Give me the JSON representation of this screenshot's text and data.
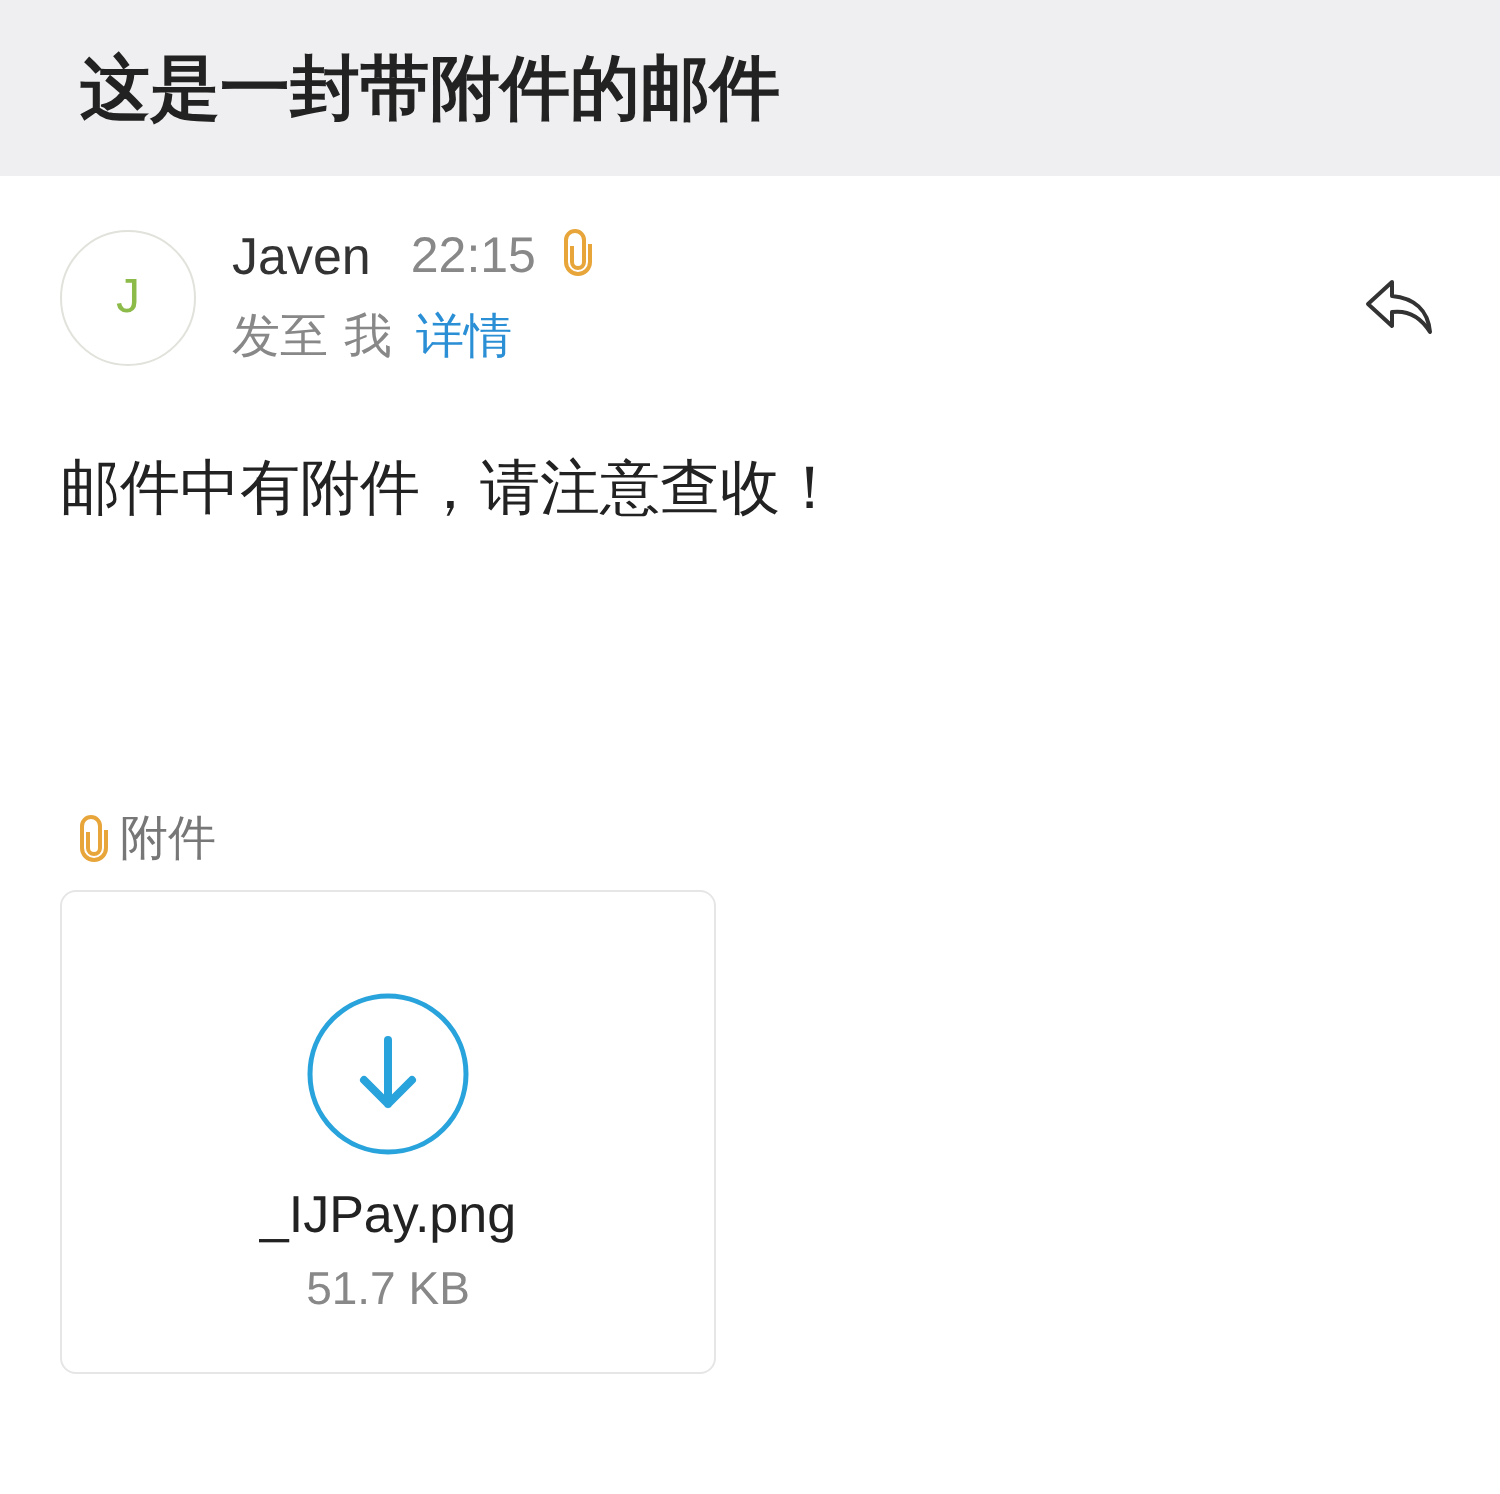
{
  "header": {
    "title": "这是一封带附件的邮件"
  },
  "message": {
    "avatar_initial": "J",
    "sender": "Javen",
    "time": "22:15",
    "has_attachment": true,
    "to_prefix": "发至",
    "recipient": "我",
    "details_link": "详情",
    "body": "邮件中有附件，请注意查收！"
  },
  "attachments": {
    "label": "附件",
    "files": [
      {
        "name": "_IJPay.png",
        "size": "51.7 KB"
      }
    ]
  }
}
